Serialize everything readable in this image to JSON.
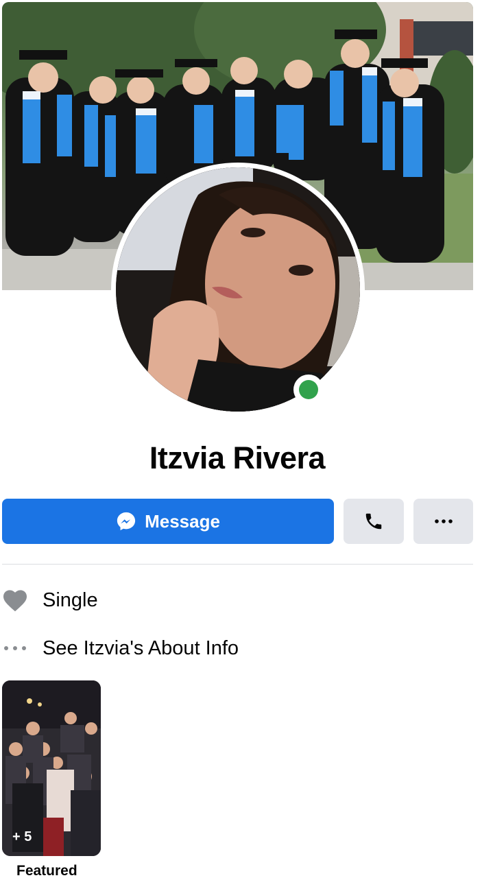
{
  "profile": {
    "name": "Itzvia Rivera",
    "online": true
  },
  "actions": {
    "message_label": "Message",
    "call_icon": "phone-icon",
    "more_icon": "more-horizontal-icon"
  },
  "info": {
    "relationship": "Single",
    "about_link": "See Itzvia's About Info"
  },
  "featured": {
    "count_label": "+ 5",
    "label": "Featured"
  },
  "colors": {
    "primary": "#1b74e4",
    "online": "#31a24c",
    "secondary_button": "#e4e6eb",
    "icon_gray": "#8a8d91"
  }
}
